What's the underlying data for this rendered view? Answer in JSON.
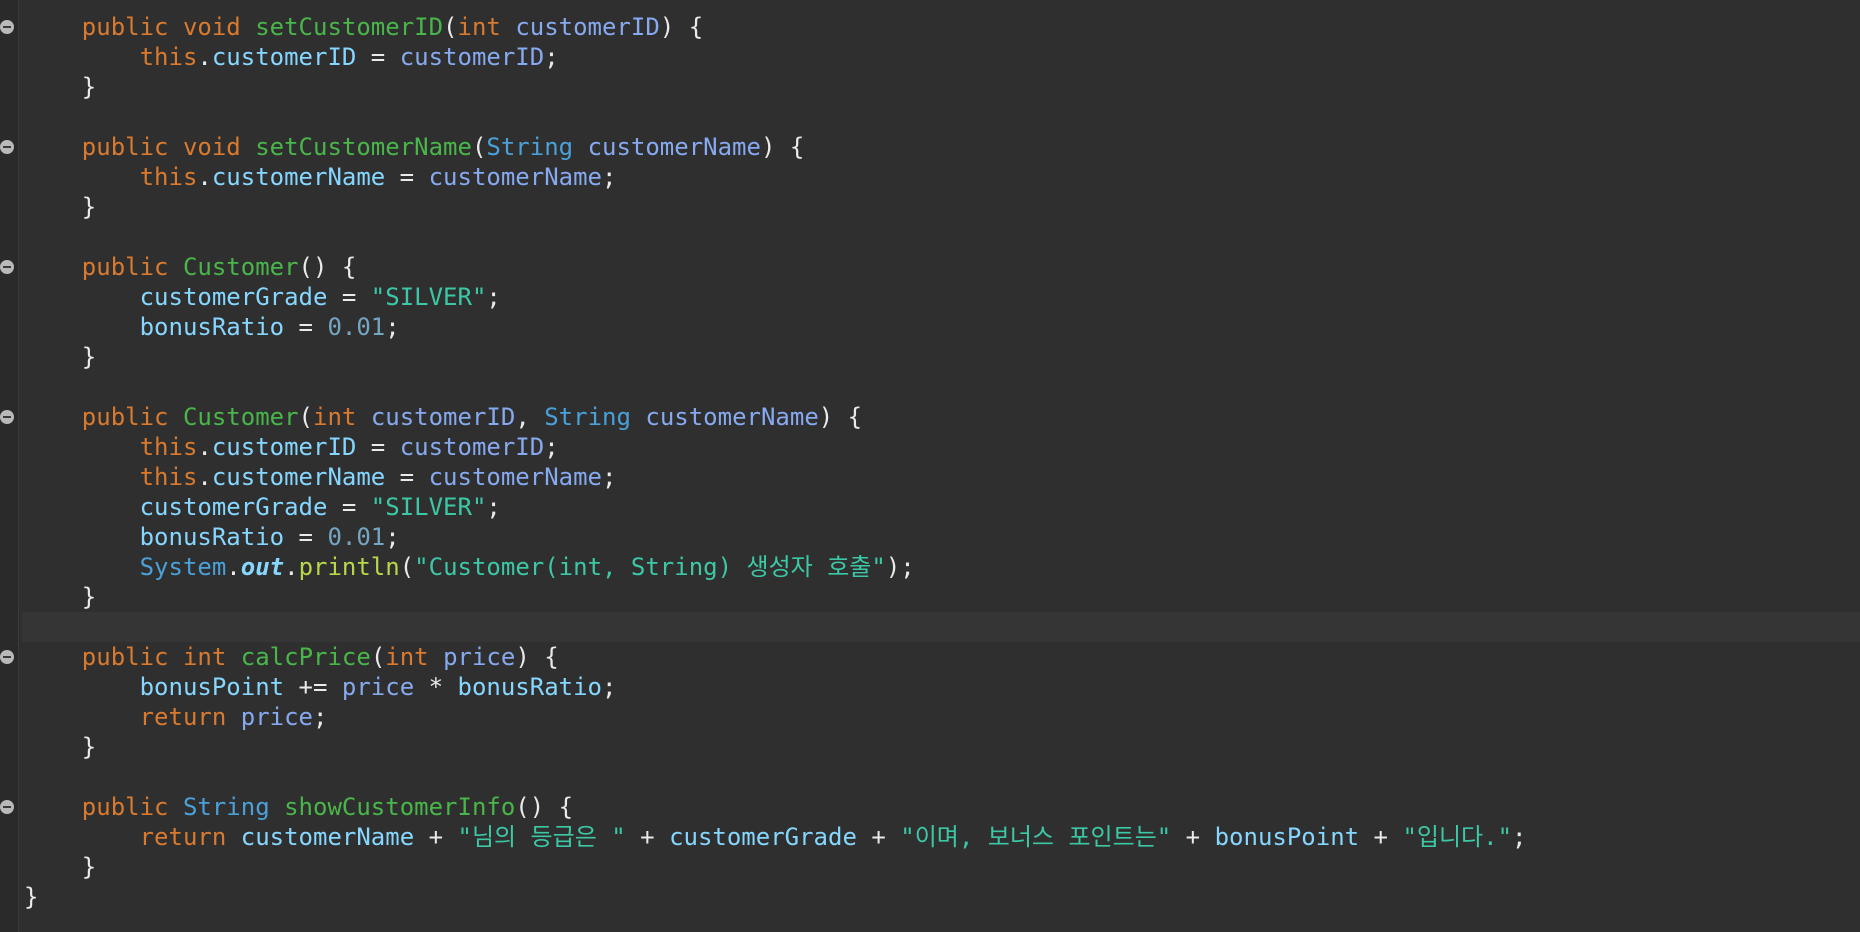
{
  "editor": {
    "language": "java",
    "current_line_index": 20,
    "folded_lines": [
      0,
      4,
      8,
      13,
      21,
      26
    ],
    "colors": {
      "background": "#2f2f2f",
      "keyword": "#d97a2e",
      "method": "#49b64a",
      "variable": "#86a9ef",
      "field": "#86d7ff",
      "type": "#4aa0d8",
      "string": "#3cc8a6",
      "number": "#74a6c3",
      "plain": "#eaeaea"
    },
    "lines": [
      [
        [
          "    ",
          "pl"
        ],
        [
          "public",
          "kw"
        ],
        [
          " ",
          "pl"
        ],
        [
          "void",
          "kw"
        ],
        [
          " ",
          "pl"
        ],
        [
          "setCustomerID",
          "fn"
        ],
        [
          "(",
          "pl"
        ],
        [
          "int",
          "kw"
        ],
        [
          " ",
          "pl"
        ],
        [
          "customerID",
          "vr"
        ],
        [
          ") {",
          "pl"
        ]
      ],
      [
        [
          "        ",
          "pl"
        ],
        [
          "this",
          "kw"
        ],
        [
          ".",
          "pl"
        ],
        [
          "customerID",
          "fd"
        ],
        [
          " = ",
          "pl"
        ],
        [
          "customerID",
          "vr"
        ],
        [
          ";",
          "pl"
        ]
      ],
      [
        [
          "    }",
          "pl"
        ]
      ],
      [],
      [
        [
          "    ",
          "pl"
        ],
        [
          "public",
          "kw"
        ],
        [
          " ",
          "pl"
        ],
        [
          "void",
          "kw"
        ],
        [
          " ",
          "pl"
        ],
        [
          "setCustomerName",
          "fn"
        ],
        [
          "(",
          "pl"
        ],
        [
          "String",
          "ty"
        ],
        [
          " ",
          "pl"
        ],
        [
          "customerName",
          "vr"
        ],
        [
          ") {",
          "pl"
        ]
      ],
      [
        [
          "        ",
          "pl"
        ],
        [
          "this",
          "kw"
        ],
        [
          ".",
          "pl"
        ],
        [
          "customerName",
          "fd"
        ],
        [
          " = ",
          "pl"
        ],
        [
          "customerName",
          "vr"
        ],
        [
          ";",
          "pl"
        ]
      ],
      [
        [
          "    }",
          "pl"
        ]
      ],
      [],
      [
        [
          "    ",
          "pl"
        ],
        [
          "public",
          "kw"
        ],
        [
          " ",
          "pl"
        ],
        [
          "Customer",
          "fn"
        ],
        [
          "() {",
          "pl"
        ]
      ],
      [
        [
          "        ",
          "pl"
        ],
        [
          "customerGrade",
          "fd"
        ],
        [
          " = ",
          "pl"
        ],
        [
          "\"SILVER\"",
          "st"
        ],
        [
          ";",
          "pl"
        ]
      ],
      [
        [
          "        ",
          "pl"
        ],
        [
          "bonusRatio",
          "fd"
        ],
        [
          " = ",
          "pl"
        ],
        [
          "0.01",
          "nm"
        ],
        [
          ";",
          "pl"
        ]
      ],
      [
        [
          "    }",
          "pl"
        ]
      ],
      [],
      [
        [
          "    ",
          "pl"
        ],
        [
          "public",
          "kw"
        ],
        [
          " ",
          "pl"
        ],
        [
          "Customer",
          "fn"
        ],
        [
          "(",
          "pl"
        ],
        [
          "int",
          "kw"
        ],
        [
          " ",
          "pl"
        ],
        [
          "customerID",
          "vr"
        ],
        [
          ", ",
          "pl"
        ],
        [
          "String",
          "ty"
        ],
        [
          " ",
          "pl"
        ],
        [
          "customerName",
          "vr"
        ],
        [
          ") {",
          "pl"
        ]
      ],
      [
        [
          "        ",
          "pl"
        ],
        [
          "this",
          "kw"
        ],
        [
          ".",
          "pl"
        ],
        [
          "customerID",
          "fd"
        ],
        [
          " = ",
          "pl"
        ],
        [
          "customerID",
          "vr"
        ],
        [
          ";",
          "pl"
        ]
      ],
      [
        [
          "        ",
          "pl"
        ],
        [
          "this",
          "kw"
        ],
        [
          ".",
          "pl"
        ],
        [
          "customerName",
          "fd"
        ],
        [
          " = ",
          "pl"
        ],
        [
          "customerName",
          "vr"
        ],
        [
          ";",
          "pl"
        ]
      ],
      [
        [
          "        ",
          "pl"
        ],
        [
          "customerGrade",
          "fd"
        ],
        [
          " = ",
          "pl"
        ],
        [
          "\"SILVER\"",
          "st"
        ],
        [
          ";",
          "pl"
        ]
      ],
      [
        [
          "        ",
          "pl"
        ],
        [
          "bonusRatio",
          "fd"
        ],
        [
          " = ",
          "pl"
        ],
        [
          "0.01",
          "nm"
        ],
        [
          ";",
          "pl"
        ]
      ],
      [
        [
          "        ",
          "pl"
        ],
        [
          "System",
          "ty"
        ],
        [
          ".",
          "pl"
        ],
        [
          "out",
          "sf"
        ],
        [
          ".",
          "pl"
        ],
        [
          "println",
          "mc"
        ],
        [
          "(",
          "pl"
        ],
        [
          "\"Customer(int, String) 생성자 호출\"",
          "st"
        ],
        [
          ");",
          "pl"
        ]
      ],
      [
        [
          "    }",
          "pl"
        ]
      ],
      [],
      [
        [
          "    ",
          "pl"
        ],
        [
          "public",
          "kw"
        ],
        [
          " ",
          "pl"
        ],
        [
          "int",
          "kw"
        ],
        [
          " ",
          "pl"
        ],
        [
          "calcPrice",
          "fn"
        ],
        [
          "(",
          "pl"
        ],
        [
          "int",
          "kw"
        ],
        [
          " ",
          "pl"
        ],
        [
          "price",
          "vr"
        ],
        [
          ") {",
          "pl"
        ]
      ],
      [
        [
          "        ",
          "pl"
        ],
        [
          "bonusPoint",
          "fd"
        ],
        [
          " += ",
          "pl"
        ],
        [
          "price",
          "vr"
        ],
        [
          " * ",
          "pl"
        ],
        [
          "bonusRatio",
          "fd"
        ],
        [
          ";",
          "pl"
        ]
      ],
      [
        [
          "        ",
          "pl"
        ],
        [
          "return",
          "kw"
        ],
        [
          " ",
          "pl"
        ],
        [
          "price",
          "vr"
        ],
        [
          ";",
          "pl"
        ]
      ],
      [
        [
          "    }",
          "pl"
        ]
      ],
      [],
      [
        [
          "    ",
          "pl"
        ],
        [
          "public",
          "kw"
        ],
        [
          " ",
          "pl"
        ],
        [
          "String",
          "ty"
        ],
        [
          " ",
          "pl"
        ],
        [
          "showCustomerInfo",
          "fn"
        ],
        [
          "() {",
          "pl"
        ]
      ],
      [
        [
          "        ",
          "pl"
        ],
        [
          "return",
          "kw"
        ],
        [
          " ",
          "pl"
        ],
        [
          "customerName",
          "fd"
        ],
        [
          " + ",
          "pl"
        ],
        [
          "\"님의 등급은 \"",
          "st"
        ],
        [
          " + ",
          "pl"
        ],
        [
          "customerGrade",
          "fd"
        ],
        [
          " + ",
          "pl"
        ],
        [
          "\"이며, 보너스 포인트는\"",
          "st"
        ],
        [
          " + ",
          "pl"
        ],
        [
          "bonusPoint",
          "fd"
        ],
        [
          " + ",
          "pl"
        ],
        [
          "\"입니다.\"",
          "st"
        ],
        [
          ";",
          "pl"
        ]
      ],
      [
        [
          "    }",
          "pl"
        ]
      ],
      [
        [
          "}",
          "pl"
        ]
      ]
    ]
  }
}
